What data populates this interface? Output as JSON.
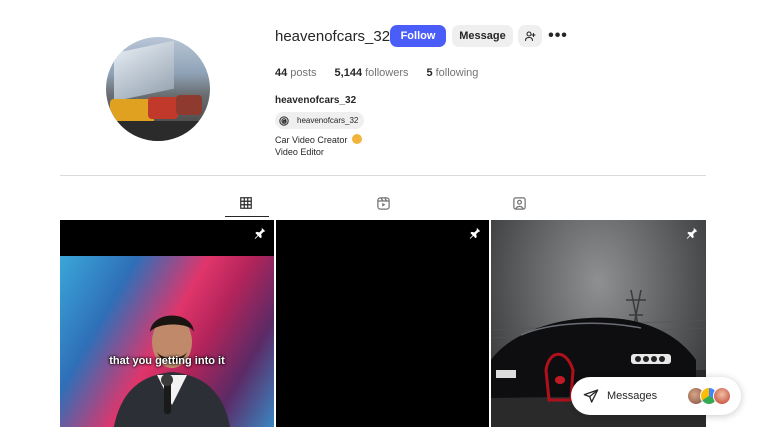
{
  "profile": {
    "username": "heavenofcars_32",
    "full_name": "heavenofcars_32",
    "avatar_icon": "profile-photo-cars",
    "buttons": {
      "follow": "Follow",
      "message": "Message",
      "suggest_icon": "person-add-icon",
      "more_icon": "more-horizontal-icon",
      "more_glyph": "•••"
    },
    "stats": {
      "posts_count": "44",
      "posts_label": "posts",
      "followers_count": "5,144",
      "followers_label": "followers",
      "following_count": "5",
      "following_label": "following"
    },
    "threads_handle": "heavenofcars_32",
    "threads_icon": "threads-icon",
    "bio": [
      "Car Video Creator",
      "Video Editor"
    ]
  },
  "tabs": [
    {
      "name": "posts",
      "icon": "grid-icon",
      "active": true
    },
    {
      "name": "reels",
      "icon": "reels-icon",
      "active": false
    },
    {
      "name": "tagged",
      "icon": "tagged-icon",
      "active": false
    }
  ],
  "posts": [
    {
      "pinned": true,
      "caption": "that you getting into it"
    },
    {
      "pinned": true,
      "caption": ""
    },
    {
      "pinned": true,
      "caption": ""
    }
  ],
  "messages_widget": {
    "label": "Messages",
    "icon": "send-icon"
  },
  "colors": {
    "accent": "#4a5df9",
    "button_bg": "#efefef",
    "text": "#262626",
    "muted": "#737373"
  }
}
